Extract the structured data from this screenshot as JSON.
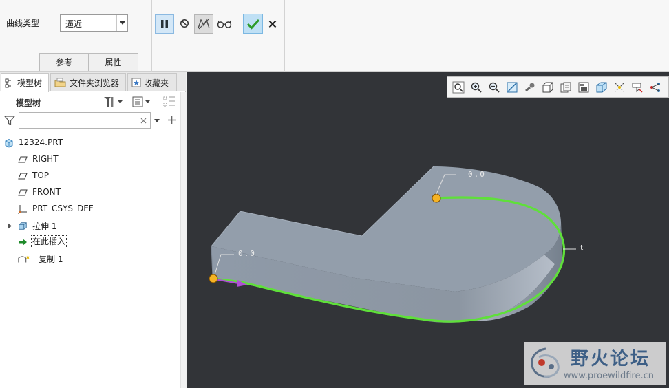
{
  "dashboard": {
    "curve_type_label": "曲线类型",
    "curve_type_value": "逼近",
    "tabs": [
      "参考",
      "属性"
    ]
  },
  "navigator": {
    "tabs": [
      "模型树",
      "文件夹浏览器",
      "收藏夹"
    ],
    "tree_title": "模型树",
    "filter_placeholder": "",
    "tree": [
      {
        "label": "12324.PRT",
        "icon": "part-icon"
      },
      {
        "label": "RIGHT",
        "icon": "datum-plane-icon"
      },
      {
        "label": "TOP",
        "icon": "datum-plane-icon"
      },
      {
        "label": "FRONT",
        "icon": "datum-plane-icon"
      },
      {
        "label": "PRT_CSYS_DEF",
        "icon": "csys-icon"
      },
      {
        "label": "拉伸 1",
        "icon": "extrude-icon"
      },
      {
        "label": "在此插入",
        "icon": "insert-here-icon"
      },
      {
        "label": "复制 1",
        "icon": "copy-surface-icon"
      }
    ]
  },
  "graphics": {
    "annot_start": "0.0",
    "annot_end": "0.0",
    "annot_right": "t",
    "background": "#323438",
    "body_color": "#8e99a7",
    "curve_color": "#5fe03a",
    "point_color": "#f5b324"
  },
  "watermark": {
    "title": "野火论坛",
    "url": "www.proewildfire.cn"
  }
}
